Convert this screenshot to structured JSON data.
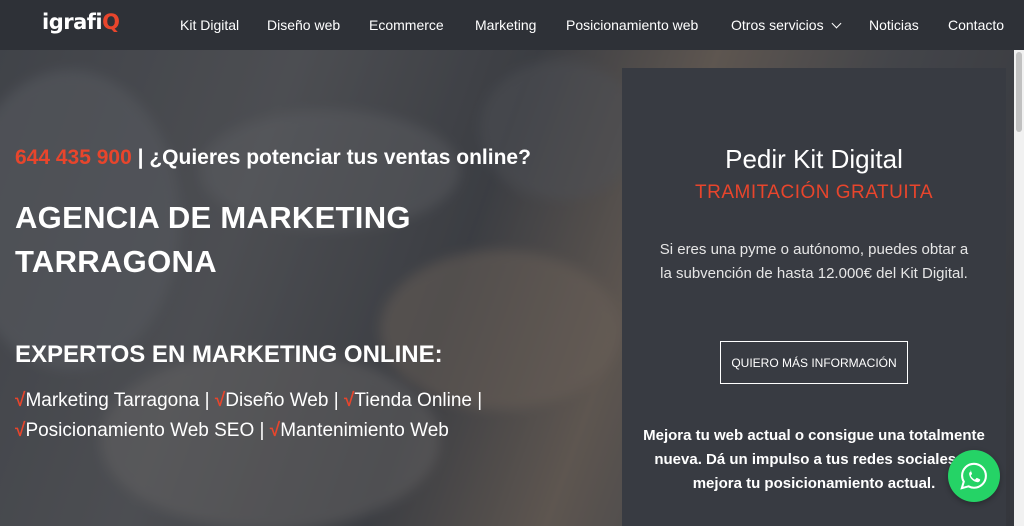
{
  "nav": {
    "logo_text": "igrafi",
    "logo_accent": "Q",
    "items": [
      {
        "label": "Kit Digital"
      },
      {
        "label": "Diseño web"
      },
      {
        "label": "Ecommerce"
      },
      {
        "label": "Marketing"
      },
      {
        "label": "Posicionamiento web"
      },
      {
        "label": "Otros servicios",
        "has_dropdown": true
      },
      {
        "label": "Noticias"
      },
      {
        "label": "Contacto"
      }
    ]
  },
  "hero": {
    "phone": "644 435 900",
    "phone_tagline": " | ¿Quieres potenciar tus ventas online?",
    "title_line1": "AGENCIA DE MARKETING",
    "title_line2": "TARRAGONA",
    "subtitle": "EXPERTOS EN MARKETING ONLINE:",
    "check_symbol": "√",
    "services": [
      "Marketing Tarragona",
      "Diseño Web",
      "Tienda Online",
      "Posicionamiento Web SEO",
      "Mantenimiento Web"
    ],
    "separator": " | "
  },
  "panel": {
    "title": "Pedir Kit Digital",
    "subtitle": "TRAMITACIÓN GRATUITA",
    "description": "Si eres una pyme o autónomo, puedes obtar a la subvención de hasta 12.000€ del Kit Digital.",
    "button_label": "QUIERO MÁS INFORMACIÓN",
    "bold_text": "Mejora tu web actual o consigue una totalmente nueva. Dá un impulso a tus redes sociales, o mejora tu posicionamiento actual."
  },
  "colors": {
    "accent": "#e8452c",
    "navbar": "#2e3137",
    "panel": "#383b42",
    "whatsapp": "#25d366"
  },
  "icons": {
    "whatsapp": "whatsapp-icon",
    "dropdown": "chevron-down-icon"
  }
}
